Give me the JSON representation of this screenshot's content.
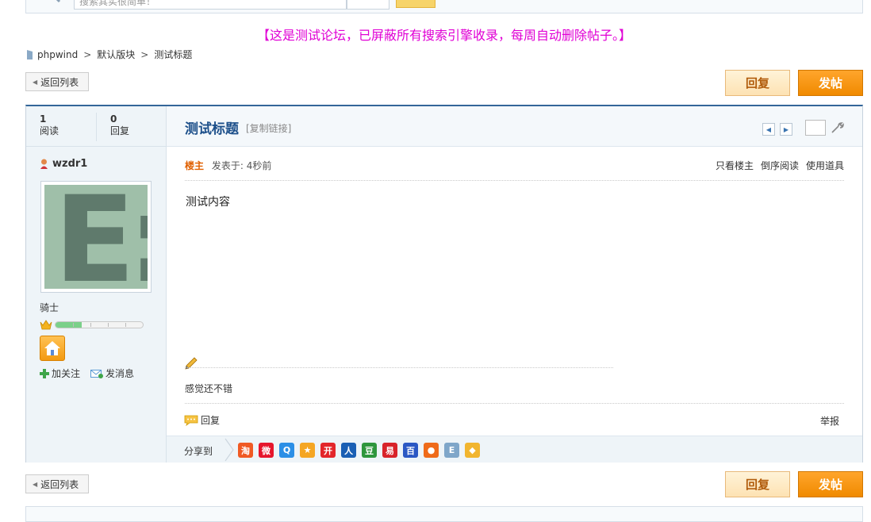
{
  "notice": "【这是测试论坛，已屏蔽所有搜索引擎收录，每周自动删除帖子。】",
  "search": {
    "placeholder": "搜索其实很简单！"
  },
  "breadcrumb": {
    "home": "phpwind",
    "forum": "默认版块",
    "topic": "测试标题",
    "separator": ">"
  },
  "buttons": {
    "back": "返回列表",
    "reply": "回复",
    "post": "发帖"
  },
  "stats": [
    {
      "value": "1",
      "label": "阅读"
    },
    {
      "value": "0",
      "label": "回复"
    }
  ],
  "thread": {
    "title": "测试标题",
    "copy_link": "[复制链接]"
  },
  "user": {
    "name": "wzdr1",
    "rank": "骑士",
    "level_fraction": 0.3,
    "follow": "加关注",
    "message": "发消息"
  },
  "post": {
    "role": "楼主",
    "time": "发表于: 4秒前",
    "only_owner": "只看楼主",
    "reverse": "倒序阅读",
    "tools": "使用道具",
    "content": "测试内容",
    "signature": "感觉还不错",
    "reply": "回复",
    "report": "举报"
  },
  "share": {
    "label": "分享到",
    "icons": [
      {
        "name": "taobao-icon",
        "glyph": "淘",
        "color": "#f05a24"
      },
      {
        "name": "weibo-icon",
        "glyph": "微",
        "color": "#e6162d"
      },
      {
        "name": "qzone-icon",
        "glyph": "Q",
        "color": "#2c8fe6"
      },
      {
        "name": "star-icon",
        "glyph": "★",
        "color": "#f5a623"
      },
      {
        "name": "kaixin-icon",
        "glyph": "开",
        "color": "#e3262b"
      },
      {
        "name": "renren-icon",
        "glyph": "人",
        "color": "#1a5fb4"
      },
      {
        "name": "douban-icon",
        "glyph": "豆",
        "color": "#2e963d"
      },
      {
        "name": "netease-icon",
        "glyph": "易",
        "color": "#d8232a"
      },
      {
        "name": "baidu-icon",
        "glyph": "百",
        "color": "#2b58c4"
      },
      {
        "name": "peach-icon",
        "glyph": "●",
        "color": "#ef6b1a"
      },
      {
        "name": "page-icon",
        "glyph": "E",
        "color": "#7fa6c9"
      },
      {
        "name": "bookmark-icon",
        "glyph": "◆",
        "color": "#f1b52f"
      }
    ]
  }
}
